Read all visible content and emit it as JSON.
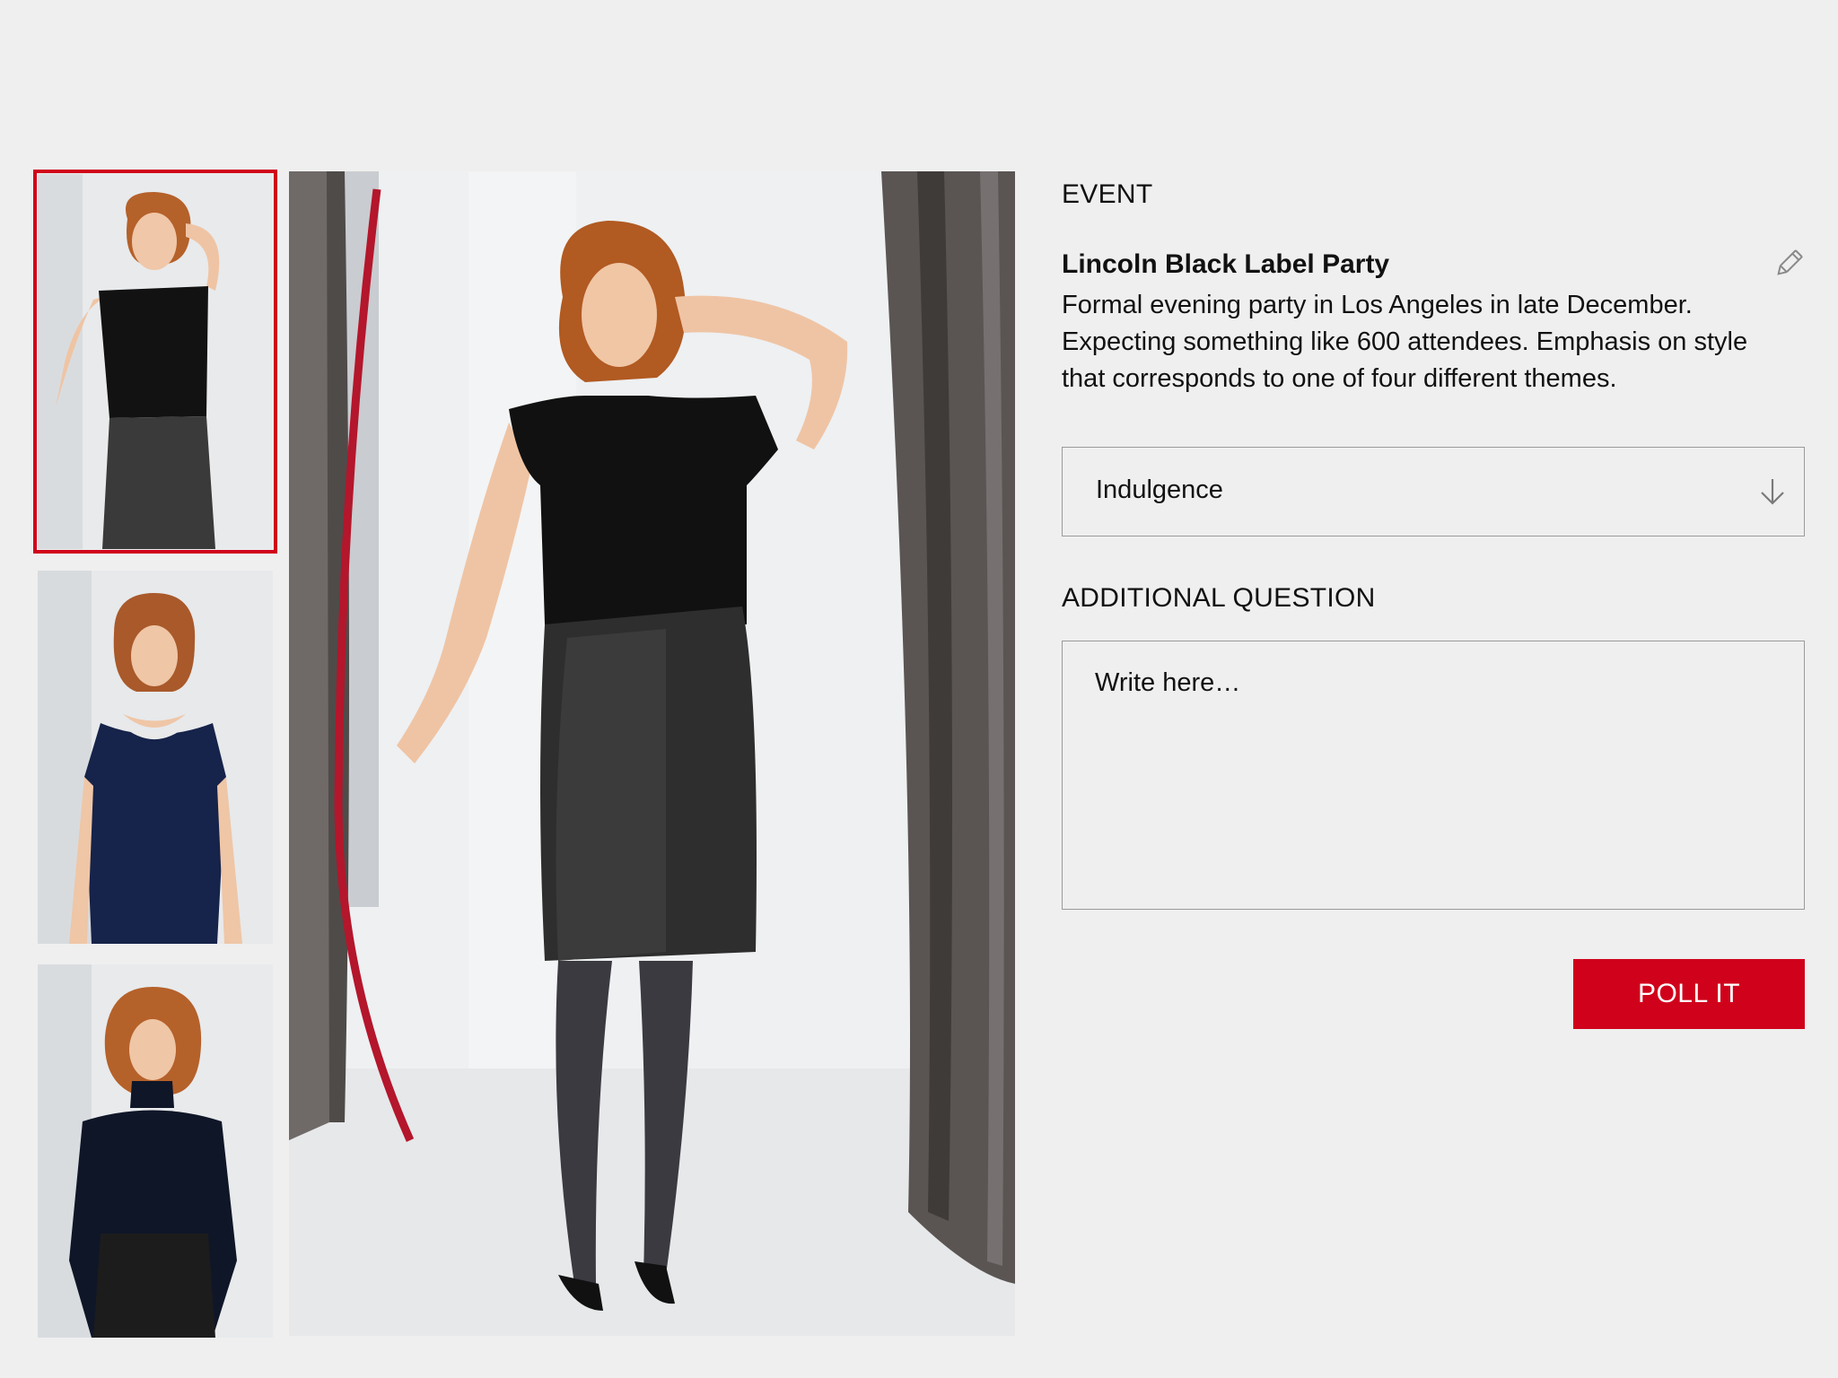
{
  "event": {
    "section_label": "EVENT",
    "title": "Lincoln Black Label Party",
    "description": "Formal evening party in Los Angeles in late December. Expecting something like 600 attendees. Emphasis on style that corresponds to one of four different themes.",
    "edit_icon": "pencil-icon"
  },
  "theme_select": {
    "selected": "Indulgence",
    "icon": "chevron-down-icon"
  },
  "additional_question": {
    "section_label": "ADDITIONAL QUESTION",
    "placeholder": "Write here…",
    "value": ""
  },
  "actions": {
    "poll_label": "POLL IT"
  },
  "gallery": {
    "selected_index": 0,
    "thumbnails": [
      {
        "outfit": "black top, leather skirt"
      },
      {
        "outfit": "navy dress"
      },
      {
        "outfit": "black turtleneck, leather skirt"
      }
    ]
  },
  "colors": {
    "accent": "#d0021b",
    "background": "#efefef",
    "border": "#9a9a9a"
  }
}
